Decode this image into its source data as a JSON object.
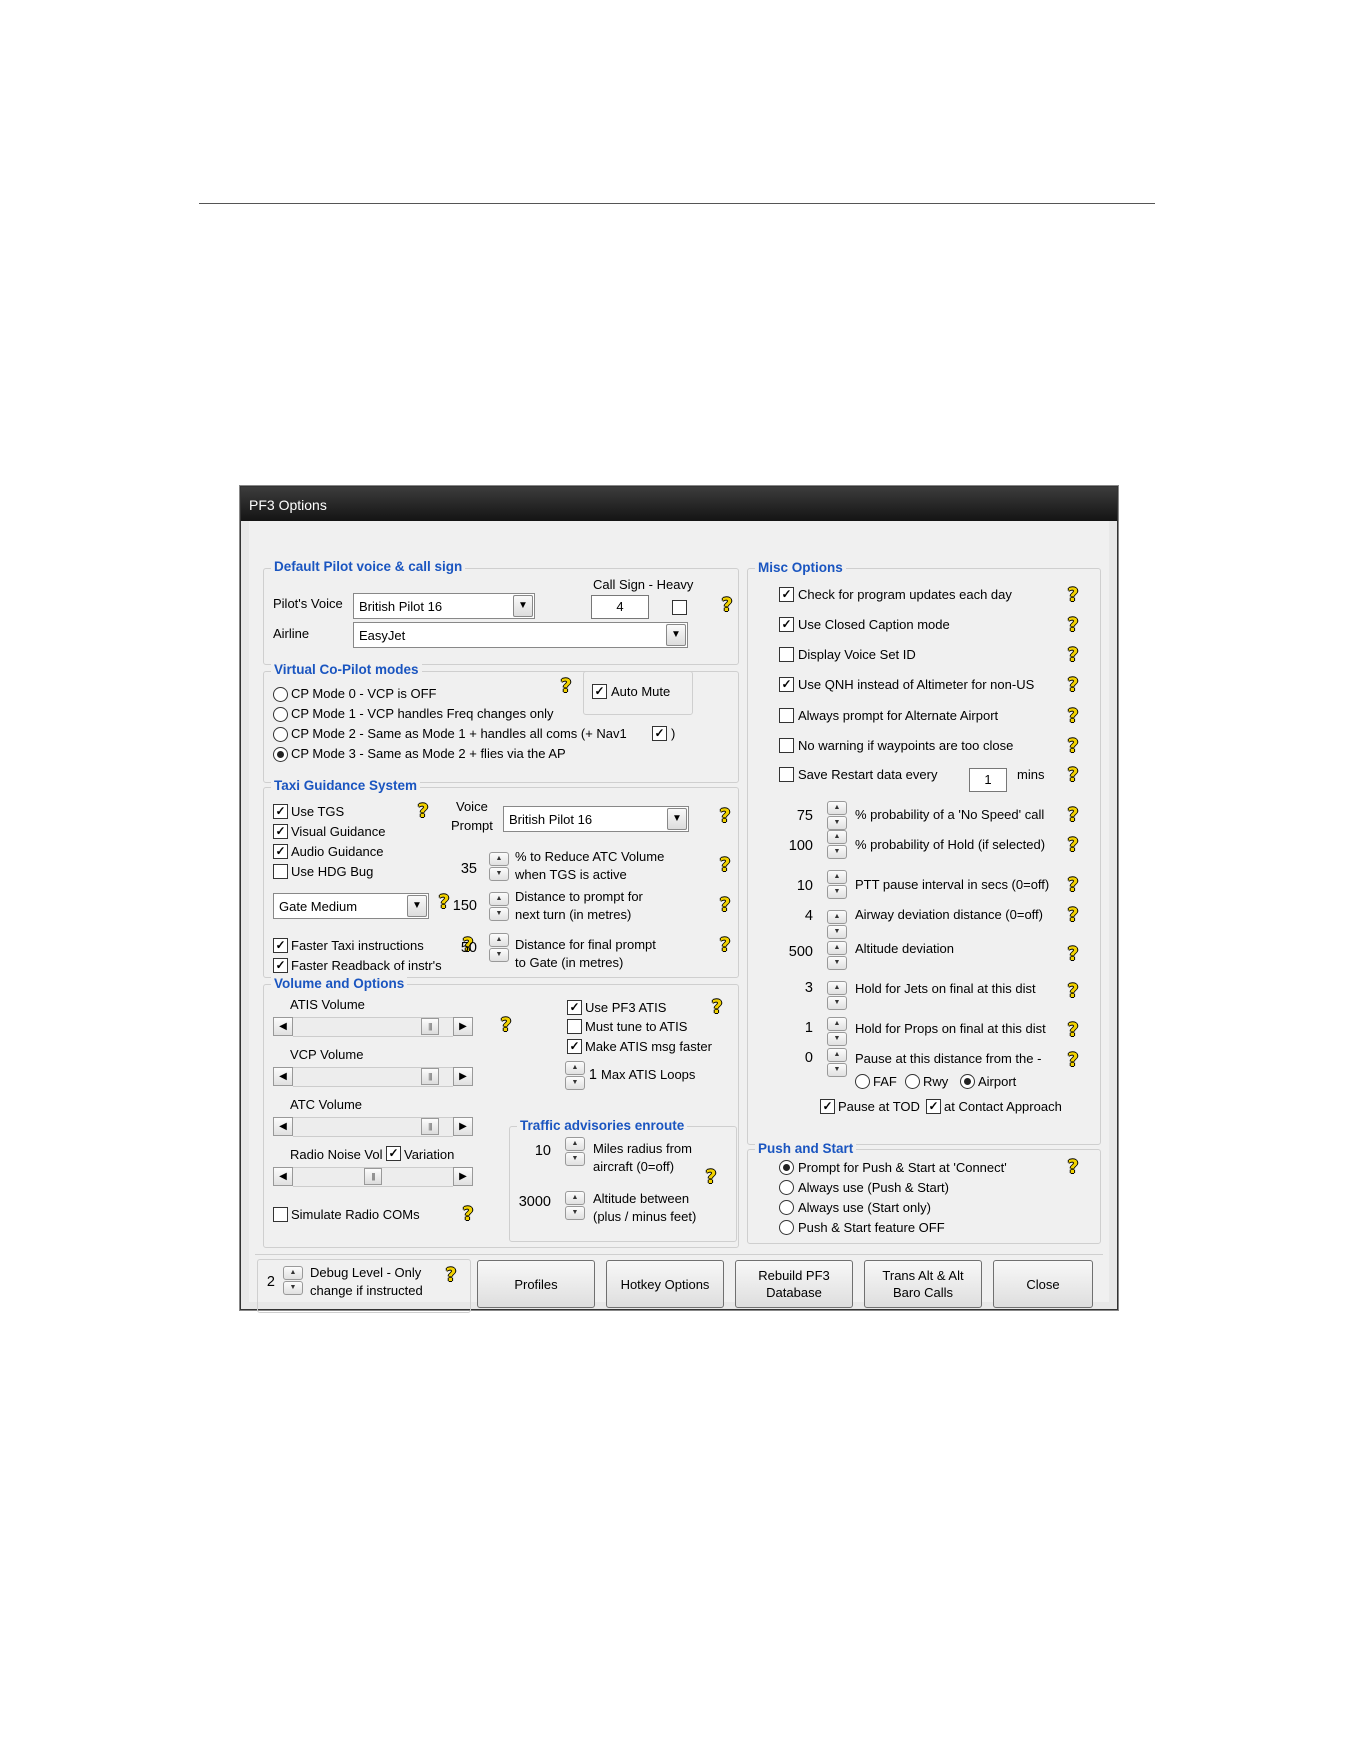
{
  "window": {
    "title": "PF3 Options"
  },
  "pilot_voice": {
    "group_title": "Default Pilot voice & call sign",
    "call_sign_label": "Call Sign - Heavy",
    "pilots_voice_label": "Pilot's Voice",
    "pilots_voice_value": "British Pilot 16",
    "call_sign_value": "4",
    "heavy_checked": false,
    "airline_label": "Airline",
    "airline_value": "EasyJet"
  },
  "copilot": {
    "group_title": "Virtual Co-Pilot modes",
    "auto_mute_label": "Auto Mute",
    "auto_mute_checked": true,
    "modes": [
      {
        "label": "CP Mode 0 - VCP is OFF",
        "selected": false
      },
      {
        "label": "CP Mode 1 - VCP handles Freq changes only",
        "selected": false
      },
      {
        "label": "CP Mode 2 - Same as Mode 1 + handles all coms (+ Nav1",
        "selected": false
      },
      {
        "label": "CP Mode 3 - Same as Mode 2 + flies via the AP",
        "selected": true
      }
    ],
    "nav1_checked": true,
    "nav1_close": ")"
  },
  "taxi": {
    "group_title": "Taxi Guidance System",
    "use_tgs": "Use TGS",
    "visual_guidance": "Visual Guidance",
    "audio_guidance": "Audio Guidance",
    "use_hdg_bug": "Use HDG Bug",
    "voice_label_1": "Voice",
    "voice_label_2": "Prompt",
    "voice_value": "British Pilot 16",
    "reduce_value": "35",
    "reduce_label_1": "% to Reduce ATC Volume",
    "reduce_label_2": "when TGS is active",
    "gate_value": "Gate Medium",
    "turn_value": "150",
    "turn_label_1": "Distance to prompt for",
    "turn_label_2": "next turn (in metres)",
    "faster_taxi": "Faster Taxi instructions",
    "faster_readback": "Faster Readback of instr's",
    "gate_dist_value": "50",
    "gate_dist_label_1": "Distance for final prompt",
    "gate_dist_label_2": "to Gate (in metres)"
  },
  "volume": {
    "group_title": "Volume and Options",
    "atis_volume": "ATIS Volume",
    "vcp_volume": "VCP Volume",
    "atc_volume": "ATC Volume",
    "radio_noise": "Radio Noise Vol",
    "variation": "Variation",
    "simulate_radio": "Simulate Radio COMs",
    "use_pf3_atis": "Use PF3 ATIS",
    "must_tune": "Must tune to ATIS",
    "make_faster": "Make ATIS msg faster",
    "loops_value": "1",
    "loops_label": "Max ATIS Loops",
    "levels": {
      "atis": 0.9,
      "vcp": 0.9,
      "atc": 0.9,
      "noise": 0.5
    }
  },
  "traffic": {
    "group_title": "Traffic advisories enroute",
    "miles_value": "10",
    "miles_label_1": "Miles radius from",
    "miles_label_2": "aircraft (0=off)",
    "alt_value": "3000",
    "alt_label_1": "Altitude between",
    "alt_label_2": "(plus / minus feet)"
  },
  "misc": {
    "group_title": "Misc Options",
    "checks": [
      {
        "label": "Check for program updates each day",
        "checked": true
      },
      {
        "label": "Use Closed Caption mode",
        "checked": true
      },
      {
        "label": "Display Voice Set ID",
        "checked": false
      },
      {
        "label": "Use QNH instead of Altimeter for non-US",
        "checked": true
      },
      {
        "label": "Always prompt for Alternate Airport",
        "checked": false
      },
      {
        "label": "No warning if waypoints are too close",
        "checked": false
      },
      {
        "label": "Save Restart data every",
        "checked": false
      }
    ],
    "restart_value": "1",
    "restart_unit": "mins",
    "spinners": [
      {
        "value": "75",
        "label": "% probability of a 'No Speed' call"
      },
      {
        "value": "100",
        "label": "% probability of Hold (if selected)"
      },
      {
        "value": "10",
        "label": "PTT pause interval in secs (0=off)"
      },
      {
        "value": "4",
        "label": "Airway deviation distance (0=off)"
      },
      {
        "value": "500",
        "label": "Altitude deviation"
      },
      {
        "value": "3",
        "label": "Hold for Jets on final at this dist"
      },
      {
        "value": "1",
        "label": "Hold for Props on final at this dist"
      },
      {
        "value": "0",
        "label": "Pause at this distance from the -"
      }
    ],
    "faf": "FAF",
    "rwy": "Rwy",
    "airport": "Airport",
    "pause_tod": "Pause at TOD",
    "contact_approach": "at Contact Approach"
  },
  "push": {
    "group_title": "Push and Start",
    "options": [
      {
        "label": "Prompt for Push & Start at 'Connect'",
        "selected": true
      },
      {
        "label": "Always use (Push & Start)",
        "selected": false
      },
      {
        "label": "Always use (Start only)",
        "selected": false
      },
      {
        "label": "Push & Start feature OFF",
        "selected": false
      }
    ]
  },
  "debug": {
    "value": "2",
    "label_1": "Debug Level - Only",
    "label_2": "change if instructed"
  },
  "buttons": {
    "profiles": "Profiles",
    "hotkey": "Hotkey Options",
    "rebuild_1": "Rebuild PF3",
    "rebuild_2": "Database",
    "trans_1": "Trans Alt & Alt",
    "trans_2": "Baro Calls",
    "close": "Close"
  }
}
